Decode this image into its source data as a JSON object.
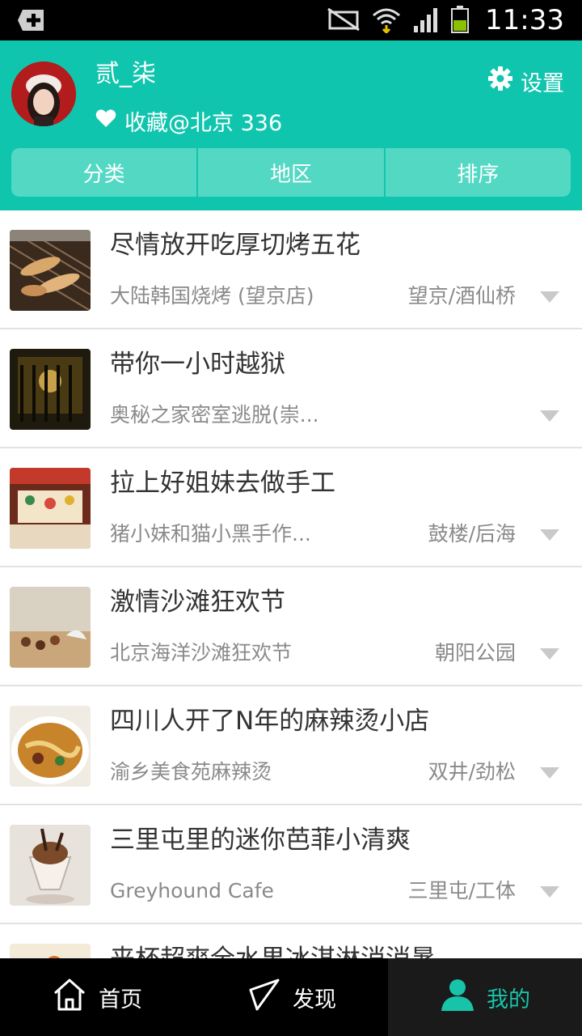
{
  "status_bar": {
    "time": "11:33"
  },
  "profile": {
    "username": "贰_柒",
    "favorites_text": "收藏@北京 336",
    "settings_label": "设置"
  },
  "filters": [
    "分类",
    "地区",
    "排序"
  ],
  "items": [
    {
      "title": "尽情放开吃厚切烤五花",
      "shop": "大陆韩国烧烤 (望京店)",
      "area": "望京/酒仙桥"
    },
    {
      "title": "带你一小时越狱",
      "shop": "奥秘之家密室逃脱(崇...",
      "area": ""
    },
    {
      "title": "拉上好姐妹去做手工",
      "shop": "猪小妹和猫小黑手作...",
      "area": "鼓楼/后海"
    },
    {
      "title": "激情沙滩狂欢节",
      "shop": "北京海洋沙滩狂欢节",
      "area": "朝阳公园"
    },
    {
      "title": "四川人开了N年的麻辣烫小店",
      "shop": "渝乡美食苑麻辣烫",
      "area": "双井/劲松"
    },
    {
      "title": "三里屯里的迷你芭菲小清爽",
      "shop": "Greyhound Cafe",
      "area": "三里屯/工体"
    },
    {
      "title": "来杯超爽全水果冰淇淋消消暑",
      "shop": "",
      "area": ""
    }
  ],
  "nav": {
    "home": "首页",
    "discover": "发现",
    "mine": "我的"
  },
  "colors": {
    "accent": "#10c5ae",
    "tab_bg": "#53d8c4",
    "active_nav": "#17c4aa"
  }
}
